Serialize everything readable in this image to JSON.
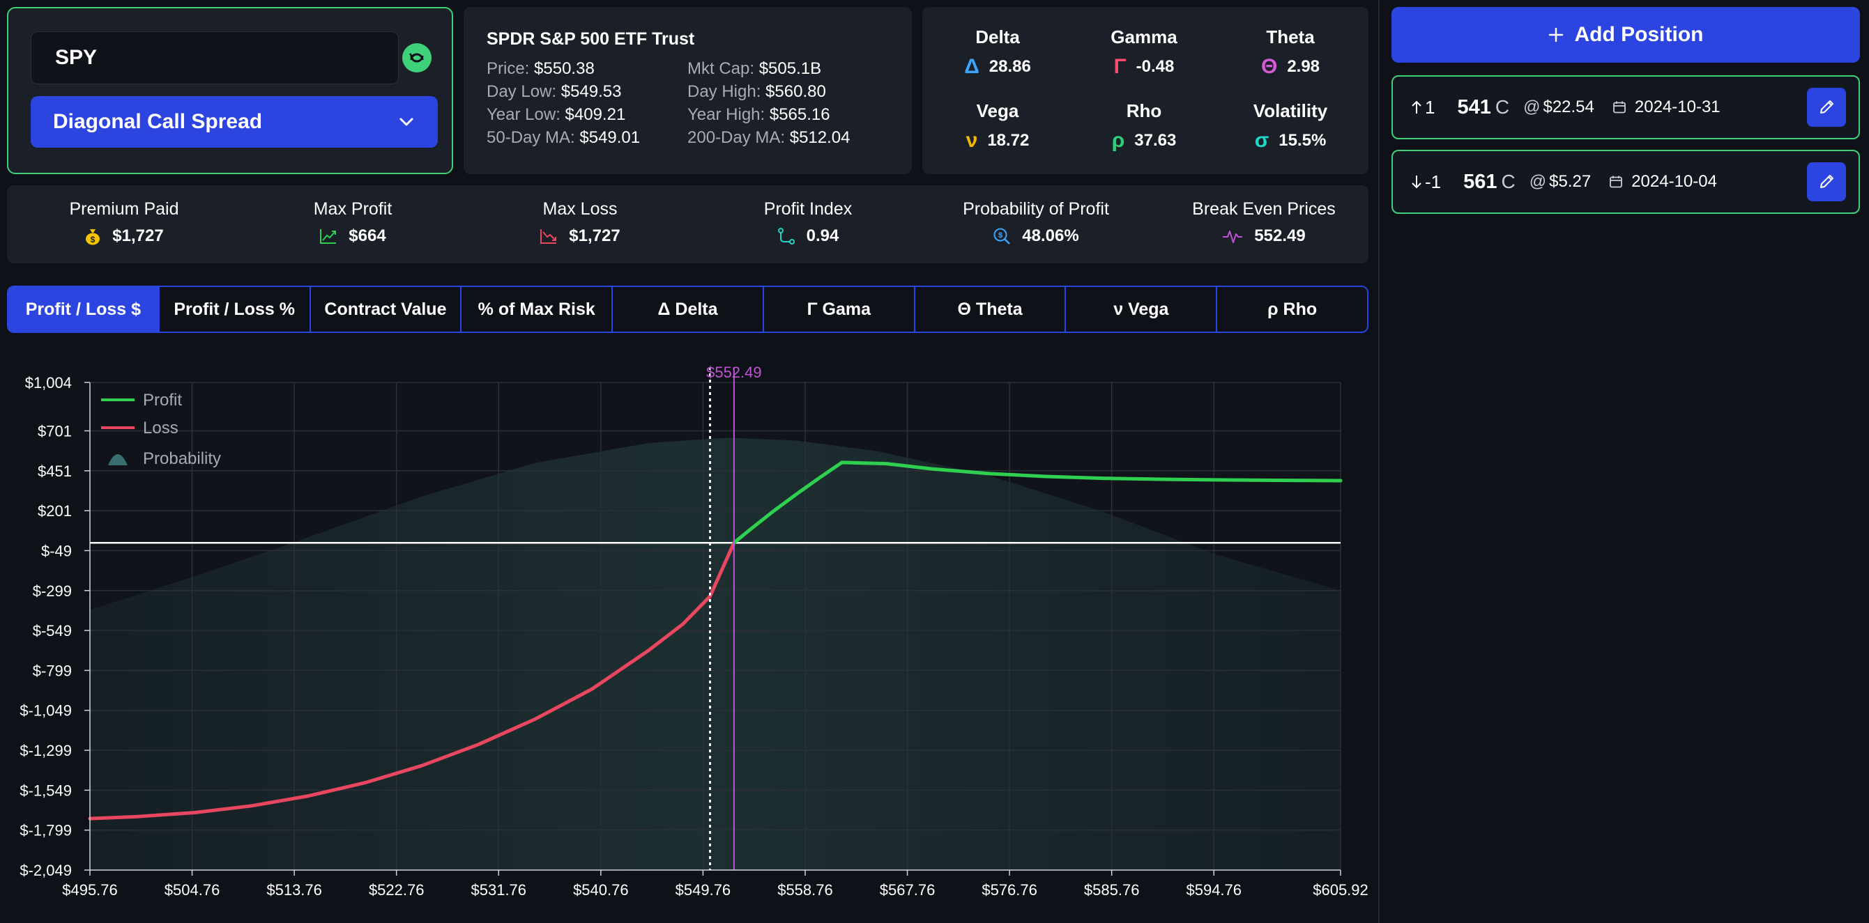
{
  "ticker": {
    "value": "SPY"
  },
  "strategy": {
    "selected": "Diagonal Call Spread"
  },
  "security": {
    "name": "SPDR S&P 500 ETF Trust",
    "fields": [
      {
        "label": "Price:",
        "value": "$550.38"
      },
      {
        "label": "Mkt Cap:",
        "value": "$505.1B"
      },
      {
        "label": "Day Low:",
        "value": "$549.53"
      },
      {
        "label": "Day High:",
        "value": "$560.80"
      },
      {
        "label": "Year Low:",
        "value": "$409.21"
      },
      {
        "label": "Year High:",
        "value": "$565.16"
      },
      {
        "label": "50-Day MA:",
        "value": "$549.01"
      },
      {
        "label": "200-Day MA:",
        "value": "$512.04"
      }
    ]
  },
  "greeks": [
    {
      "title": "Delta",
      "symbol": "Δ",
      "value": "28.86",
      "color": "#3aa6ff"
    },
    {
      "title": "Gamma",
      "symbol": "Γ",
      "value": "-0.48",
      "color": "#ff4d6d"
    },
    {
      "title": "Theta",
      "symbol": "Θ",
      "value": "2.98",
      "color": "#d35bd6"
    },
    {
      "title": "Vega",
      "symbol": "ν",
      "value": "18.72",
      "color": "#f5b800"
    },
    {
      "title": "Rho",
      "symbol": "ρ",
      "value": "37.63",
      "color": "#2fd07a"
    },
    {
      "title": "Volatility",
      "symbol": "σ",
      "value": "15.5%",
      "color": "#20d6c7"
    }
  ],
  "metrics": [
    {
      "label": "Premium Paid",
      "value": "$1,727",
      "icon": "money-bag-icon"
    },
    {
      "label": "Max Profit",
      "value": "$664",
      "icon": "trend-up-icon"
    },
    {
      "label": "Max Loss",
      "value": "$1,727",
      "icon": "trend-down-icon"
    },
    {
      "label": "Profit Index",
      "value": "0.94",
      "icon": "route-icon"
    },
    {
      "label": "Probability of Profit",
      "value": "48.06%",
      "icon": "search-dollar-icon"
    },
    {
      "label": "Break Even Prices",
      "value": "552.49",
      "icon": "pulse-icon"
    }
  ],
  "tabs": [
    {
      "label": "Profit / Loss $",
      "active": true
    },
    {
      "label": "Profit / Loss %",
      "active": false
    },
    {
      "label": "Contract Value",
      "active": false
    },
    {
      "label": "% of Max Risk",
      "active": false
    },
    {
      "label": "Δ Delta",
      "active": false
    },
    {
      "label": "Γ Gama",
      "active": false
    },
    {
      "label": "Θ Theta",
      "active": false
    },
    {
      "label": "ν Vega",
      "active": false
    },
    {
      "label": "ρ Rho",
      "active": false
    }
  ],
  "add_position": {
    "label": "Add Position",
    "icon": "plus-icon"
  },
  "positions": [
    {
      "direction": "up",
      "qty": "1",
      "strike": "541",
      "type": "C",
      "at": "@",
      "price": "$22.54",
      "expiry": "2024-10-31"
    },
    {
      "direction": "down",
      "qty": "-1",
      "strike": "561",
      "type": "C",
      "at": "@",
      "price": "$5.27",
      "expiry": "2024-10-04"
    }
  ],
  "colors": {
    "accent": "#2c45e0",
    "profit": "#2fd04f",
    "loss": "#e8475f",
    "breakeven": "#c153d6",
    "card_border": "#3fd07a"
  },
  "chart_data": {
    "type": "line",
    "xlim": [
      495.76,
      605.92
    ],
    "ylim": [
      -2049,
      1004
    ],
    "x_ticks": [
      "$495.76",
      "$504.76",
      "$513.76",
      "$522.76",
      "$531.76",
      "$540.76",
      "$549.76",
      "$558.76",
      "$567.76",
      "$576.76",
      "$585.76",
      "$594.76",
      "$605.92"
    ],
    "y_ticks": [
      "$1,004",
      "$701",
      "$451",
      "$201",
      "$-49",
      "$-299",
      "$-549",
      "$-799",
      "$-1,049",
      "$-1,299",
      "$-1,549",
      "$-1,799",
      "$-2,049"
    ],
    "legend": [
      "Profit",
      "Loss",
      "Probability"
    ],
    "legend_position": "top-left",
    "grid": true,
    "current_price": 550.38,
    "break_even": 552.49,
    "break_even_label": "$552.49",
    "series": [
      {
        "name": "Profit",
        "x": [
          552.49,
          554.0,
          556.0,
          558.0,
          560.0,
          562.0,
          566.0,
          570.0,
          575.0,
          580.0,
          585.0,
          590.0,
          595.0,
          600.0,
          605.92
        ],
        "y": [
          0,
          88,
          200,
          305,
          406,
          503,
          495,
          462,
          433,
          415,
          404,
          398,
          394,
          391,
          389
        ]
      },
      {
        "name": "Loss",
        "x": [
          495.76,
          500.0,
          505.0,
          510.0,
          515.0,
          520.0,
          525.0,
          530.0,
          535.0,
          540.0,
          545.0,
          548.0,
          550.38,
          552.49
        ],
        "y": [
          -1727,
          -1714,
          -1689,
          -1647,
          -1585,
          -1502,
          -1395,
          -1262,
          -1103,
          -915,
          -672,
          -508,
          -335,
          0
        ]
      },
      {
        "name": "Probability",
        "type": "area",
        "x": [
          495.76,
          505.0,
          515.0,
          525.0,
          535.0,
          545.0,
          552.0,
          558.0,
          565.0,
          575.0,
          585.0,
          595.0,
          605.92
        ],
        "y": [
          -420,
          -210,
          35,
          290,
          500,
          625,
          658,
          640,
          575,
          420,
          195,
          -75,
          -300
        ]
      }
    ]
  }
}
